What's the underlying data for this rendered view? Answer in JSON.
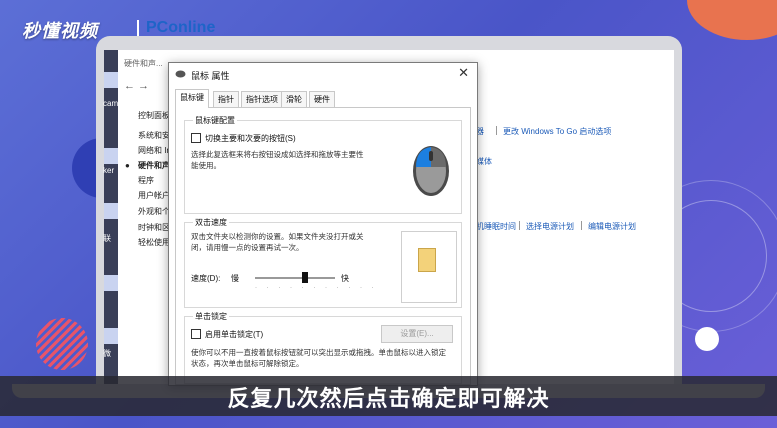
{
  "branding": {
    "logo_text": "秒懂视频",
    "pconline": "PConline"
  },
  "control_panel": {
    "title": "硬件和声...",
    "nav_arrows": "←   →",
    "sidebar": [
      {
        "label": "控制面板"
      },
      {
        "label": "系统和安"
      },
      {
        "label": "网络和 In"
      },
      {
        "label": "硬件和声"
      },
      {
        "label": "程序"
      },
      {
        "label": "用户帐户"
      },
      {
        "label": "外观和个"
      },
      {
        "label": "时钟和区"
      },
      {
        "label": "轻松使用"
      }
    ],
    "links": {
      "link1": "器",
      "link2": "更改 Windows To Go 启动选项",
      "link3": "媒体",
      "link4": "机睡眠时间",
      "link5": "选择电源计划",
      "link6": "编辑电源计划"
    }
  },
  "desktop": {
    "labels": [
      "cam",
      "ker",
      "联",
      "微"
    ]
  },
  "dialog": {
    "title": "鼠标 属性",
    "close": "✕",
    "tabs": [
      "鼠标键",
      "指针",
      "指针选项",
      "滑轮",
      "硬件"
    ],
    "button_config": {
      "group_title": "鼠标键配置",
      "checkbox_label": "切换主要和次要的按钮(S)",
      "description": "选择此复选框来将右按钮设成如选择和拖放等主要性能使用。"
    },
    "double_click": {
      "group_title": "双击速度",
      "description": "双击文件夹以检测你的设置。如果文件夹没打开或关闭，请用慢一点的设置再试一次。",
      "speed_label": "速度(D):",
      "slow": "慢",
      "fast": "快",
      "speed_level": 0.62
    },
    "click_lock": {
      "group_title": "单击锁定",
      "checkbox_label": "启用单击锁定(T)",
      "settings_button": "设置(E)...",
      "description": "使你可以不用一直按着鼠标按钮就可以突出显示或拖拽。单击鼠标以进入锁定状态，再次单击鼠标可解除锁定。"
    }
  },
  "subtitle": "反复几次然后点击确定即可解决"
}
